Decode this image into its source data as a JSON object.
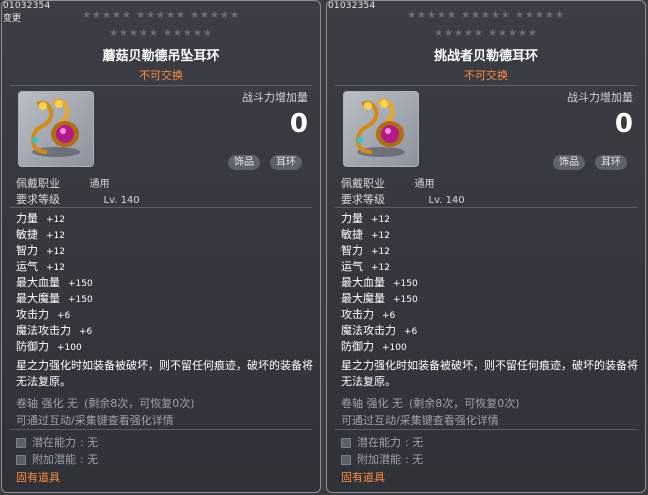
{
  "tooltips": [
    {
      "item_id": "01032354",
      "change_tag": "变更",
      "star_rows": [
        "★★★★★  ★★★★★  ★★★★★",
        "★★★★★  ★★★★★"
      ],
      "name": "蘑菇贝勒德吊坠耳环",
      "tradable": "不可交换",
      "power_label": "战斗力增加量",
      "power_value": "0",
      "tags": [
        "饰品",
        "耳环"
      ],
      "requirements": [
        {
          "label": "佩戴职业",
          "value": "通用"
        },
        {
          "label": "要求等级",
          "value": "Lv. 140"
        }
      ],
      "stats": [
        {
          "label": "力量",
          "value": "+12"
        },
        {
          "label": "敏捷",
          "value": "+12"
        },
        {
          "label": "智力",
          "value": "+12"
        },
        {
          "label": "运气",
          "value": "+12"
        },
        {
          "label": "最大血量",
          "value": "+150"
        },
        {
          "label": "最大魔量",
          "value": "+150"
        },
        {
          "label": "攻击力",
          "value": "+6"
        },
        {
          "label": "魔法攻击力",
          "value": "+6"
        },
        {
          "label": "防御力",
          "value": "+100"
        }
      ],
      "description": "星之力强化时如装备被破坏，则不留任何痕迹，破坏的装备将无法复原。",
      "scroll_info": "卷轴 强化 无",
      "scroll_remaining": "(剩余8次，可恢复0次)",
      "upgrade_hint": "可通过互动/采集键查看强化详情",
      "potential_label": "潜在能力",
      "potential_value": ": 无",
      "additional_label": "附加潜能",
      "additional_value": ": 无",
      "owned": "固有道具"
    },
    {
      "item_id": "01032354",
      "star_rows": [
        "★★★★★  ★★★★★  ★★★★★",
        "★★★★★  ★★★★★"
      ],
      "name": "挑战者贝勒德耳环",
      "tradable": "不可交换",
      "power_label": "战斗力增加量",
      "power_value": "0",
      "tags": [
        "饰品",
        "耳环"
      ],
      "requirements": [
        {
          "label": "佩戴职业",
          "value": "通用"
        },
        {
          "label": "要求等级",
          "value": "Lv. 140"
        }
      ],
      "stats": [
        {
          "label": "力量",
          "value": "+12"
        },
        {
          "label": "敏捷",
          "value": "+12"
        },
        {
          "label": "智力",
          "value": "+12"
        },
        {
          "label": "运气",
          "value": "+12"
        },
        {
          "label": "最大血量",
          "value": "+150"
        },
        {
          "label": "最大魔量",
          "value": "+150"
        },
        {
          "label": "攻击力",
          "value": "+6"
        },
        {
          "label": "魔法攻击力",
          "value": "+6"
        },
        {
          "label": "防御力",
          "value": "+100"
        }
      ],
      "description": "星之力强化时如装备被破坏，则不留任何痕迹，破坏的装备将无法复原。",
      "scroll_info": "卷轴 强化 无",
      "scroll_remaining": "(剩余8次，可恢复0次)",
      "upgrade_hint": "可通过互动/采集键查看强化详情",
      "potential_label": "潜在能力",
      "potential_value": ": 无",
      "additional_label": "附加潜能",
      "additional_value": ": 无",
      "owned": "固有道具"
    }
  ]
}
